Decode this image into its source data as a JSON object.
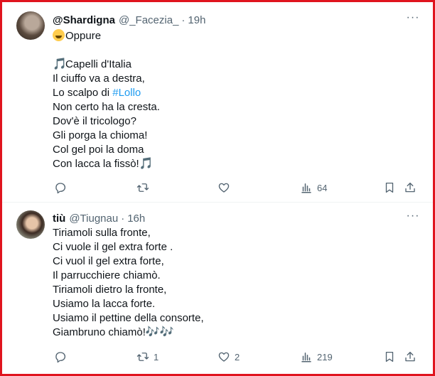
{
  "tweets": [
    {
      "display_name": "@Shardigna",
      "handle": "@_Facezia_",
      "separator": "·",
      "time": "19h",
      "more": "···",
      "first_line": "Oppure",
      "song_title": "Capelli d'Italia",
      "lines": [
        "Il ciuffo va a destra,",
        "Lo scalpo di ",
        "Non certo ha la cresta.",
        "Dov'è il tricologo?",
        "Gli porga la chioma!",
        "Col gel poi la doma",
        "Con lacca la fissò!"
      ],
      "hashtag": "#Lollo",
      "stats": {
        "replies": "",
        "reposts": "",
        "likes": "",
        "views": "64"
      }
    },
    {
      "display_name": "tiù",
      "handle": "@Tiugnau",
      "separator": "·",
      "time": "16h",
      "more": "···",
      "lines": [
        "Tiriamoli sulla fronte,",
        "Ci vuole il gel extra forte .",
        "Ci vuol il gel extra forte,",
        "Il parrucchiere chiamò.",
        "Tiriamoli dietro la fronte,",
        "Usiamo la lacca forte.",
        "Usiamo il pettine della consorte,",
        "Giambruno chiamò!"
      ],
      "stats": {
        "replies": "",
        "reposts": "1",
        "likes": "2",
        "views": "219"
      }
    }
  ],
  "emojis": {
    "laugh": "face-with-tears-of-joy",
    "note": "🎵",
    "notes": "🎶"
  },
  "colors": {
    "frame": "#e0141e",
    "hashtag": "#1d9bf0",
    "secondary_text": "#536471"
  }
}
